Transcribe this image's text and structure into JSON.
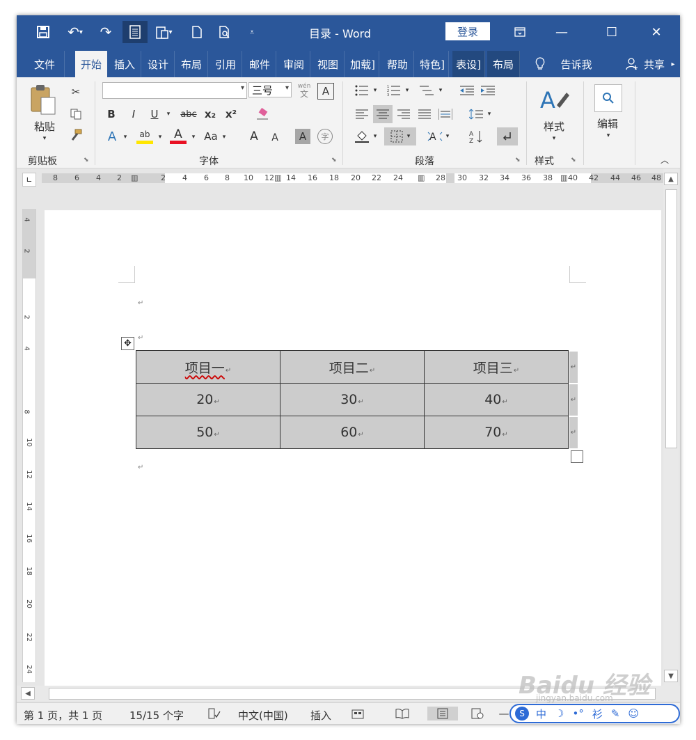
{
  "window": {
    "title": "目录 - Word",
    "login": "登录"
  },
  "tabs": [
    "文件",
    "开始",
    "插入",
    "设计",
    "布局",
    "引用",
    "邮件",
    "审阅",
    "视图",
    "加载]",
    "帮助",
    "特色]",
    "表设]",
    "布局"
  ],
  "tell_me": "告诉我",
  "share": "共享",
  "ribbon": {
    "clipboard": {
      "paste": "粘贴",
      "label": "剪贴板"
    },
    "font": {
      "label": "字体",
      "size": "三号",
      "wen": "wén",
      "wen_char": "文",
      "bold": "B",
      "italic": "I",
      "underline": "U",
      "strike": "abc",
      "sub": "x₂",
      "sup": "x²",
      "text_effect": "A",
      "highlight": "ab",
      "font_color": "A",
      "case": "Aa",
      "grow": "A",
      "shrink": "A",
      "shading": "A",
      "enclose": "字"
    },
    "paragraph": {
      "label": "段落"
    },
    "styles": {
      "label": "样式",
      "button": "样式"
    },
    "editing": {
      "button": "编辑"
    }
  },
  "ruler": {
    "h_left": [
      "8",
      "6",
      "4",
      "2"
    ],
    "h_right": [
      "2",
      "4",
      "6",
      "8",
      "10",
      "12",
      "14",
      "16",
      "18",
      "20",
      "22",
      "24",
      "28",
      "30",
      "32",
      "34",
      "36",
      "38",
      "40",
      "42",
      "44",
      "46",
      "48"
    ],
    "v": [
      "4",
      "2",
      "2",
      "4",
      "8",
      "10",
      "12",
      "14",
      "16",
      "18",
      "20",
      "22",
      "24"
    ]
  },
  "table": {
    "rows": [
      [
        "项目一",
        "项目二",
        "项目三"
      ],
      [
        "20",
        "30",
        "40"
      ],
      [
        "50",
        "60",
        "70"
      ]
    ],
    "paragraph_mark": "↵"
  },
  "status": {
    "page": "第 1 页，共 1 页",
    "words": "15/15 个字",
    "language": "中文(中国)",
    "mode": "插入"
  },
  "ime": {
    "lang": "中",
    "moon": "☽",
    "dots": "•°",
    "wrench": "✎",
    "skin": "☺",
    "tshirt": "衫"
  },
  "watermark": {
    "main": "Baidu 经验",
    "sub": "jingyan.baidu.com"
  }
}
